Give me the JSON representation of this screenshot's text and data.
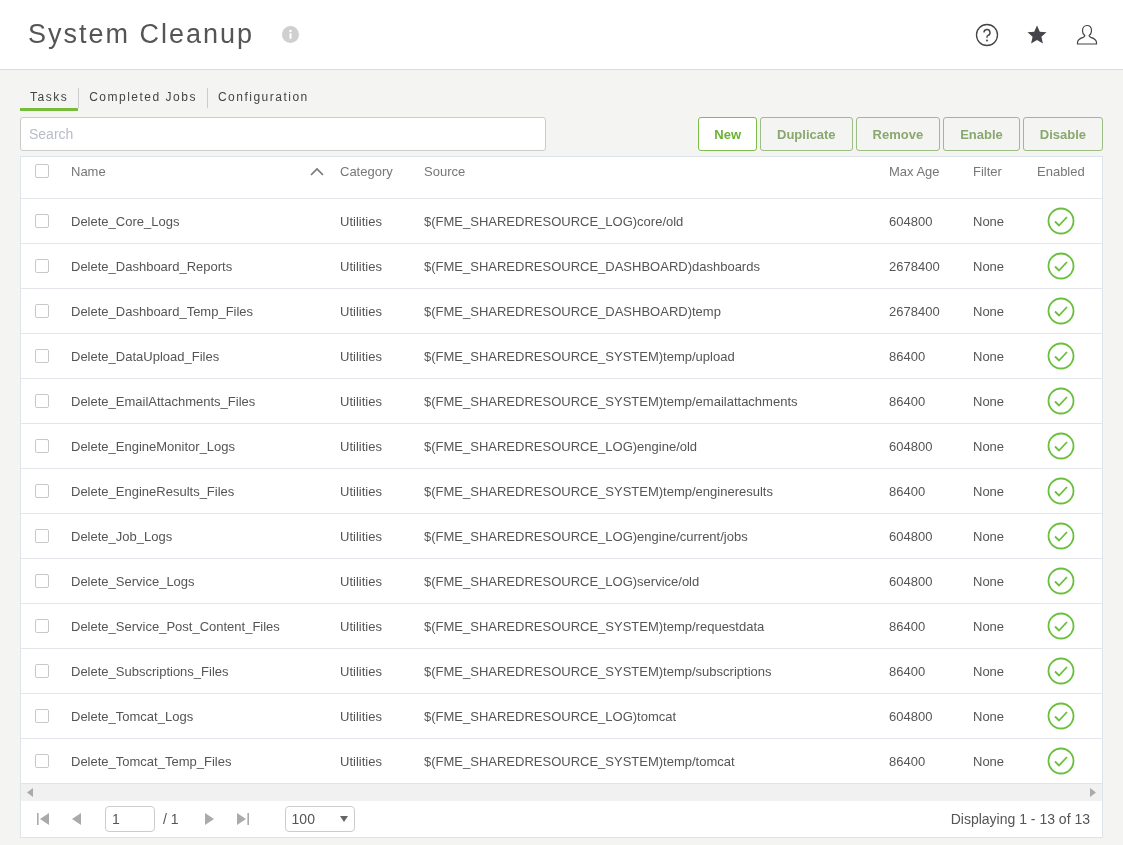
{
  "header": {
    "title": "System Cleanup"
  },
  "tabs": [
    {
      "label": "Tasks",
      "selected": true
    },
    {
      "label": "Completed Jobs",
      "selected": false
    },
    {
      "label": "Configuration",
      "selected": false
    }
  ],
  "search": {
    "placeholder": "Search"
  },
  "buttons": [
    {
      "label": "New",
      "kind": "primary"
    },
    {
      "label": "Duplicate",
      "kind": "default"
    },
    {
      "label": "Remove",
      "kind": "default"
    },
    {
      "label": "Enable",
      "kind": "default"
    },
    {
      "label": "Disable",
      "kind": "default"
    }
  ],
  "table": {
    "columns": [
      {
        "label": "Name",
        "sorted": true
      },
      {
        "label": "Category",
        "sorted": false
      },
      {
        "label": "Source",
        "sorted": false
      },
      {
        "label": "Max Age",
        "sorted": false
      },
      {
        "label": "Filter",
        "sorted": false
      },
      {
        "label": "Enabled",
        "sorted": false
      }
    ],
    "all_checked": false,
    "rows": [
      {
        "checked": false,
        "name": "Delete_Core_Logs",
        "category": "Utilities",
        "source": "$(FME_SHAREDRESOURCE_LOG)core/old",
        "max_age": "604800",
        "filter": "None",
        "enabled": true
      },
      {
        "checked": false,
        "name": "Delete_Dashboard_Reports",
        "category": "Utilities",
        "source": "$(FME_SHAREDRESOURCE_DASHBOARD)dashboards",
        "max_age": "2678400",
        "filter": "None",
        "enabled": true
      },
      {
        "checked": false,
        "name": "Delete_Dashboard_Temp_Files",
        "category": "Utilities",
        "source": "$(FME_SHAREDRESOURCE_DASHBOARD)temp",
        "max_age": "2678400",
        "filter": "None",
        "enabled": true
      },
      {
        "checked": false,
        "name": "Delete_DataUpload_Files",
        "category": "Utilities",
        "source": "$(FME_SHAREDRESOURCE_SYSTEM)temp/upload",
        "max_age": "86400",
        "filter": "None",
        "enabled": true
      },
      {
        "checked": false,
        "name": "Delete_EmailAttachments_Files",
        "category": "Utilities",
        "source": "$(FME_SHAREDRESOURCE_SYSTEM)temp/emailattachments",
        "max_age": "86400",
        "filter": "None",
        "enabled": true
      },
      {
        "checked": false,
        "name": "Delete_EngineMonitor_Logs",
        "category": "Utilities",
        "source": "$(FME_SHAREDRESOURCE_LOG)engine/old",
        "max_age": "604800",
        "filter": "None",
        "enabled": true
      },
      {
        "checked": false,
        "name": "Delete_EngineResults_Files",
        "category": "Utilities",
        "source": "$(FME_SHAREDRESOURCE_SYSTEM)temp/engineresults",
        "max_age": "86400",
        "filter": "None",
        "enabled": true
      },
      {
        "checked": false,
        "name": "Delete_Job_Logs",
        "category": "Utilities",
        "source": "$(FME_SHAREDRESOURCE_LOG)engine/current/jobs",
        "max_age": "604800",
        "filter": "None",
        "enabled": true
      },
      {
        "checked": false,
        "name": "Delete_Service_Logs",
        "category": "Utilities",
        "source": "$(FME_SHAREDRESOURCE_LOG)service/old",
        "max_age": "604800",
        "filter": "None",
        "enabled": true
      },
      {
        "checked": false,
        "name": "Delete_Service_Post_Content_Files",
        "category": "Utilities",
        "source": "$(FME_SHAREDRESOURCE_SYSTEM)temp/requestdata",
        "max_age": "86400",
        "filter": "None",
        "enabled": true
      },
      {
        "checked": false,
        "name": "Delete_Subscriptions_Files",
        "category": "Utilities",
        "source": "$(FME_SHAREDRESOURCE_SYSTEM)temp/subscriptions",
        "max_age": "86400",
        "filter": "None",
        "enabled": true
      },
      {
        "checked": false,
        "name": "Delete_Tomcat_Logs",
        "category": "Utilities",
        "source": "$(FME_SHAREDRESOURCE_LOG)tomcat",
        "max_age": "604800",
        "filter": "None",
        "enabled": true
      },
      {
        "checked": false,
        "name": "Delete_Tomcat_Temp_Files",
        "category": "Utilities",
        "source": "$(FME_SHAREDRESOURCE_SYSTEM)temp/tomcat",
        "max_age": "86400",
        "filter": "None",
        "enabled": true
      }
    ]
  },
  "pager": {
    "page": "1",
    "total_pages": "/ 1",
    "page_size": "100",
    "summary": "Displaying 1 - 13 of 13"
  }
}
